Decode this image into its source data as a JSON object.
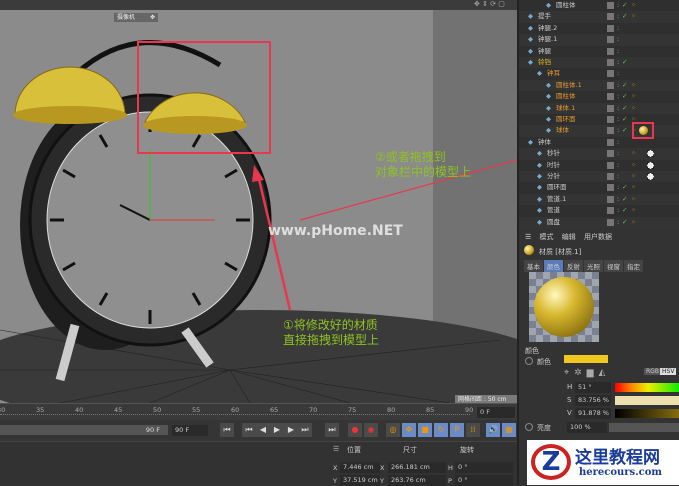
{
  "viewport": {
    "camera_label": "摄像机",
    "grid_spacing": "网格间距 : 50 cm",
    "watermark": "www.pHome.NET",
    "annotation_1": [
      "①将修改好的材质",
      "直接拖拽到模型上"
    ],
    "annotation_2": [
      "②或者拖拽到",
      "对象栏中的模型上"
    ]
  },
  "timeline": {
    "ticks": [
      "30",
      "35",
      "40",
      "45",
      "50",
      "55",
      "60",
      "65",
      "70",
      "75",
      "80",
      "85",
      "90"
    ],
    "current_frame": "0 F",
    "end_frame_slider": "90 F",
    "end_frame_field": "90 F"
  },
  "coordinates": {
    "position_label": "位置",
    "size_label": "尺寸",
    "rotation_label": "旋转",
    "rows": [
      {
        "axis": "X",
        "position": "7.446 cm",
        "size_axis": "X",
        "size": "266.181 cm",
        "rot_axis": "H",
        "rotation": "0 °"
      },
      {
        "axis": "Y",
        "position": "37.519 cm",
        "size_axis": "Y",
        "size": "263.76 cm",
        "rot_axis": "P",
        "rotation": "0 °"
      }
    ]
  },
  "objects": [
    {
      "name": "圆柱体",
      "indent": 3,
      "color": "#ccc",
      "vis": true,
      "tag": true
    },
    {
      "name": "提手",
      "indent": 1,
      "color": "#ccc",
      "vis": true,
      "tag": true
    },
    {
      "name": "钟腿.2",
      "indent": 1,
      "color": "#ccc",
      "vis": false,
      "tag": false
    },
    {
      "name": "钟腿.1",
      "indent": 1,
      "color": "#ccc",
      "vis": false,
      "tag": false
    },
    {
      "name": "钟腿",
      "indent": 1,
      "color": "#ccc",
      "vis": false,
      "tag": false
    },
    {
      "name": "铃铛",
      "indent": 1,
      "color": "#e8c020",
      "vis": true,
      "tag": false
    },
    {
      "name": "钟耳",
      "indent": 2,
      "color": "#e89a30",
      "vis": false,
      "tag": false
    },
    {
      "name": "圆柱体.1",
      "indent": 3,
      "color": "#e89a30",
      "vis": true,
      "tag": true
    },
    {
      "name": "圆柱体",
      "indent": 3,
      "color": "#e89a30",
      "vis": true,
      "tag": true
    },
    {
      "name": "球体.1",
      "indent": 3,
      "color": "#e89a30",
      "vis": true,
      "tag": true
    },
    {
      "name": "圆环面",
      "indent": 3,
      "color": "#e89a30",
      "vis": true,
      "tag": true
    },
    {
      "name": "球体",
      "indent": 3,
      "color": "#e89a30",
      "vis": true,
      "tag": true,
      "material": true
    },
    {
      "name": "钟体",
      "indent": 1,
      "color": "#ccc",
      "vis": false,
      "tag": false
    },
    {
      "name": "秒针",
      "indent": 2,
      "color": "#ccc",
      "vis": false,
      "tag": true,
      "checker": true
    },
    {
      "name": "时针",
      "indent": 2,
      "color": "#ccc",
      "vis": false,
      "tag": true,
      "checker": true
    },
    {
      "name": "分针",
      "indent": 2,
      "color": "#ccc",
      "vis": false,
      "tag": true,
      "checker": true
    },
    {
      "name": "圆环面",
      "indent": 2,
      "color": "#ccc",
      "vis": true,
      "tag": true
    },
    {
      "name": "管道.1",
      "indent": 2,
      "color": "#ccc",
      "vis": true,
      "tag": true
    },
    {
      "name": "管道",
      "indent": 2,
      "color": "#ccc",
      "vis": true,
      "tag": true
    },
    {
      "name": "圆盘",
      "indent": 2,
      "color": "#ccc",
      "vis": true,
      "tag": true
    }
  ],
  "attributes": {
    "menu": [
      "模式",
      "编辑",
      "用户数据"
    ],
    "title": "材质 [材质.1]",
    "tabs": [
      "基本",
      "颜色",
      "反射",
      "光照",
      "视窗",
      "指定"
    ],
    "active_tab": "颜色",
    "section": "颜色",
    "color_label": "颜色",
    "color_value": "#f0c820",
    "mode_rgb": "RGB",
    "mode_hsv": "HSV",
    "h_label": "H",
    "h": "51 °",
    "s_label": "S",
    "s": "83.756 %",
    "v_label": "V",
    "v": "91.878 %",
    "brightness_label": "亮度",
    "brightness": "100 %"
  },
  "site_watermark": {
    "title": "这里教程网",
    "url": "herecours.com"
  },
  "colors": {
    "highlight": "#e8384f",
    "annotation": "#8fc31f"
  }
}
